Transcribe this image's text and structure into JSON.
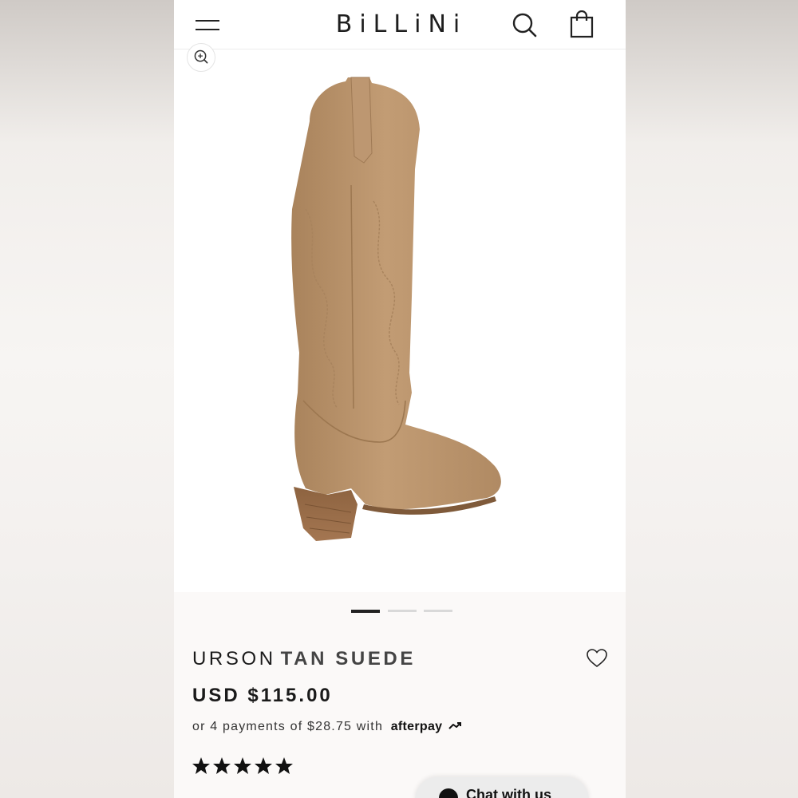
{
  "header": {
    "logo_text": "BiLLiNi"
  },
  "product": {
    "brand": "URSON",
    "variant": "TAN SUEDE",
    "price": "USD $115.00",
    "installments_text": "or 4 payments of $28.75 with",
    "afterpay_label": "afterpay",
    "rating": 5,
    "gallery_count": 3,
    "gallery_active_index": 1
  },
  "chat": {
    "label": "Chat with us"
  },
  "colors": {
    "boot_tan": "#b9946c",
    "heel_brown": "#9a6e48",
    "text_dark": "#1a1a1a"
  },
  "icons": {
    "menu": "menu-icon",
    "search": "search-icon",
    "cart": "shopping-bag-icon",
    "zoom": "zoom-in-icon",
    "wishlist": "heart-icon",
    "rating": "star-icon"
  }
}
